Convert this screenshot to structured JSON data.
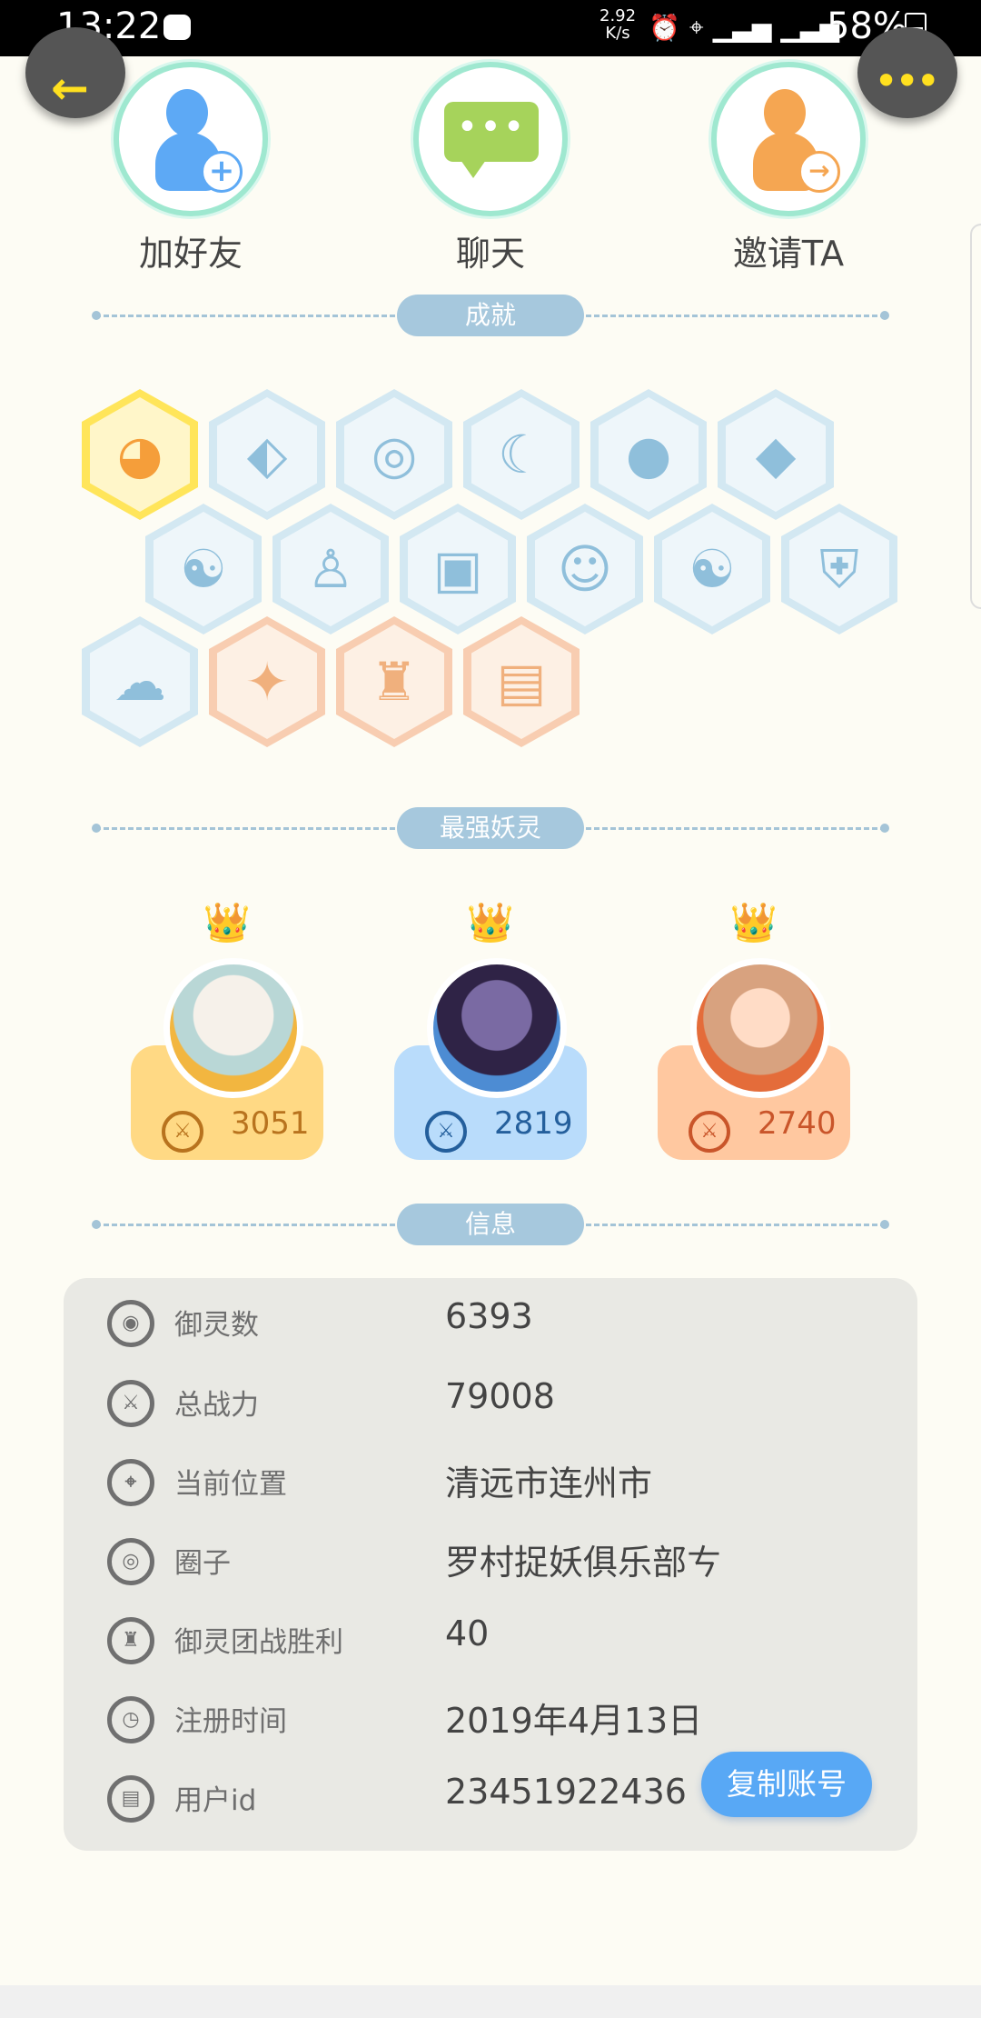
{
  "status_bar": {
    "time": "13:22",
    "network_speed": "2.92\nK/s",
    "battery": "58%"
  },
  "actions": [
    {
      "label": "加好友"
    },
    {
      "label": "聊天"
    },
    {
      "label": "邀请TA"
    }
  ],
  "sections": {
    "achievements": "成就",
    "strongest_spirits": "最强妖灵",
    "info": "信息"
  },
  "achievement_badges": [
    "fox-head",
    "shoe",
    "pin",
    "moon",
    "ball",
    "crystal",
    "yin-yang",
    "person",
    "cart",
    "cat",
    "scroll",
    "shield",
    "cloud",
    "dragon",
    "statue",
    "book"
  ],
  "spirits": [
    {
      "power": "3051"
    },
    {
      "power": "2819"
    },
    {
      "power": "2740"
    }
  ],
  "info_rows": [
    {
      "label": "御灵数",
      "value": "6393"
    },
    {
      "label": "总战力",
      "value": "79008"
    },
    {
      "label": "当前位置",
      "value": "清远市连州市"
    },
    {
      "label": "圈子",
      "value": "罗村捉妖俱乐部ㄘ"
    },
    {
      "label": "御灵团战胜利",
      "value": "40"
    },
    {
      "label": "注册时间",
      "value": "2019年4月13日"
    },
    {
      "label": "用户id",
      "value": "23451922436"
    }
  ],
  "copy_button": "复制账号",
  "colors": {
    "background": "#fdfcf4",
    "accent_blue": "#58a8f5",
    "teal_ring": "#9fe8d0",
    "section_pill": "#a6c8dd"
  }
}
